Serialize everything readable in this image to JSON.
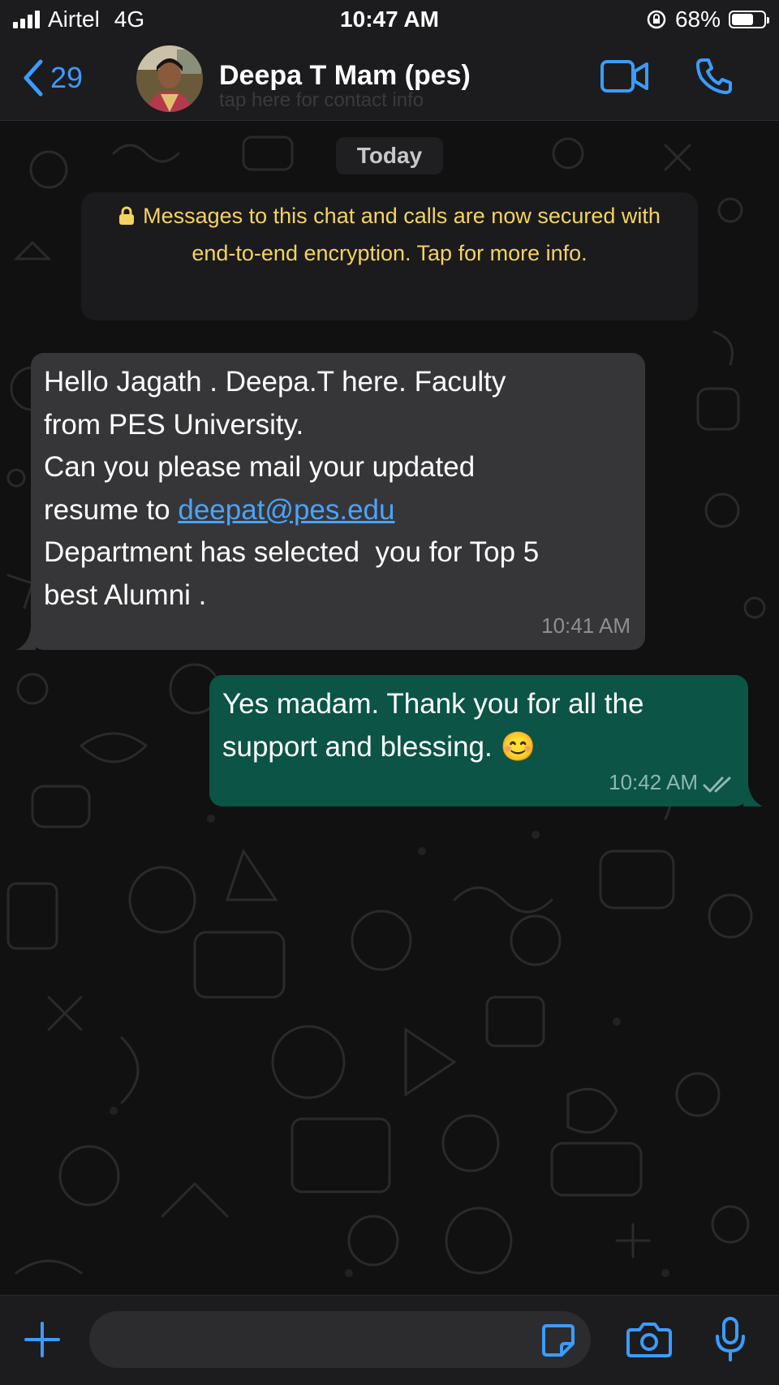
{
  "status_bar": {
    "carrier": "Airtel",
    "network": "4G",
    "time": "10:47 AM",
    "battery_percent": "68%",
    "battery_level": 0.68
  },
  "header": {
    "back_count": "29",
    "contact_name": "Deepa T Mam (pes)",
    "subtitle": "tap here for contact info"
  },
  "chat": {
    "date_label": "Today",
    "encryption_notice": "Messages to this chat and calls are now secured with end-to-end encryption. Tap for more info.",
    "messages": [
      {
        "direction": "incoming",
        "text_before_link": "Hello Jagath . Deepa.T here. Faculty\nfrom PES University.\nCan you please mail your updated\nresume to ",
        "link": "deepat@pes.edu",
        "text_after_link": "\nDepartment has selected  you for Top 5\nbest Alumni .",
        "time": "10:41 AM"
      },
      {
        "direction": "outgoing",
        "text": "Yes madam. Thank you for all the support and blessing.  😊",
        "time": "10:42 AM",
        "status": "read"
      }
    ]
  },
  "colors": {
    "accent": "#3b9cff",
    "incoming_bubble": "#363638",
    "outgoing_bubble": "#0b5446",
    "notice_text": "#f4d35e"
  },
  "icons": [
    "back-chevron-icon",
    "video-call-icon",
    "phone-icon",
    "lock-icon",
    "plus-icon",
    "sticker-icon",
    "camera-icon",
    "mic-icon",
    "double-check-icon"
  ]
}
